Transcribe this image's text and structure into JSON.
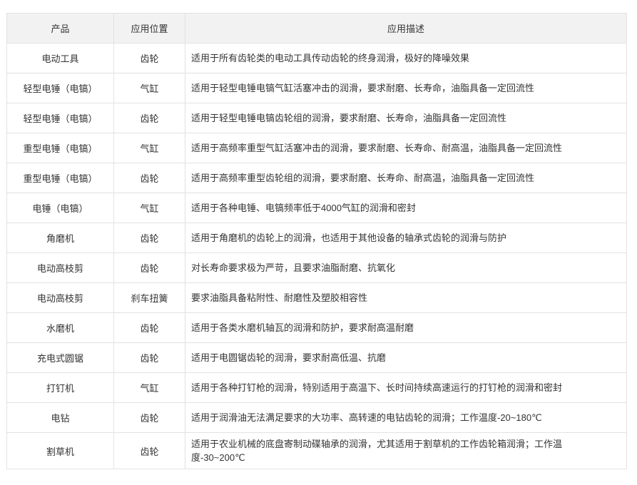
{
  "headers": [
    "产品",
    "应用位置",
    "应用描述"
  ],
  "rows": [
    {
      "product": "电动工具",
      "position": "齿轮",
      "description": "适用于所有齿轮类的电动工具传动齿轮的终身润滑，极好的降噪效果"
    },
    {
      "product": "轻型电锤（电镐）",
      "position": "气缸",
      "description": "适用于轻型电锤电镐气缸活塞冲击的润滑，要求耐磨、长寿命，油脂具备一定回流性"
    },
    {
      "product": "轻型电锤（电镐）",
      "position": "齿轮",
      "description": "适用于轻型电锤电镐齿轮组的润滑，要求耐磨、长寿命，油脂具备一定回流性"
    },
    {
      "product": "重型电锤（电镐）",
      "position": "气缸",
      "description": "适用于高频率重型气缸活塞冲击的润滑，要求耐磨、长寿命、耐高温，油脂具备一定回流性"
    },
    {
      "product": "重型电锤（电镐）",
      "position": "齿轮",
      "description": "适用于高频率重型齿轮组的润滑，要求耐磨、长寿命、耐高温，油脂具备一定回流性"
    },
    {
      "product": "电锤（电镐）",
      "position": "气缸",
      "description": "适用于各种电锤、电镐频率低于4000气缸的润滑和密封"
    },
    {
      "product": "角磨机",
      "position": "齿轮",
      "description": "适用于角磨机的齿轮上的润滑，也适用于其他设备的轴承式齿轮的润滑与防护"
    },
    {
      "product": "电动高枝剪",
      "position": "齿轮",
      "description": "对长寿命要求极为严苛，且要求油脂耐磨、抗氧化"
    },
    {
      "product": "电动高枝剪",
      "position": "刹车扭簧",
      "description": "要求油脂具备粘附性、耐磨性及塑胶相容性"
    },
    {
      "product": "水磨机",
      "position": "齿轮",
      "description": "适用于各类水磨机轴瓦的润滑和防护，要求耐高温耐磨"
    },
    {
      "product": "充电式圆锯",
      "position": "齿轮",
      "description": "适用于电圆锯齿轮的润滑，要求耐高低温、抗磨"
    },
    {
      "product": "打钉机",
      "position": "气缸",
      "description": "适用于各种打钉枪的润滑，特别适用于高温下、长时间持续高速运行的打钉枪的润滑和密封"
    },
    {
      "product": "电钻",
      "position": "齿轮",
      "description": "适用于润滑油无法满足要求的大功率、高转速的电钻齿轮的润滑；工作温度-20~180℃"
    },
    {
      "product": "割草机",
      "position": "齿轮",
      "description": "适用于农业机械的底盘寄制动碟轴承的润滑，尤其适用于割草机的工作齿轮箱润滑；工作温度-30~200℃"
    }
  ]
}
